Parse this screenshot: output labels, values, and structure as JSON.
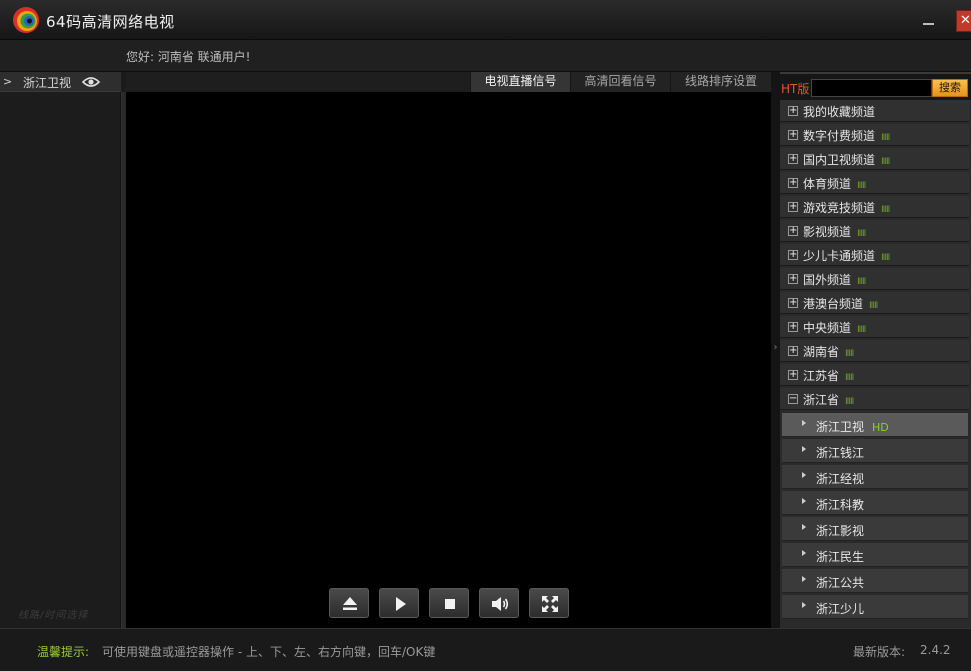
{
  "app": {
    "title": "64码高清网络电视"
  },
  "header": {
    "greeting": "您好: 河南省  联通用户!"
  },
  "left": {
    "arrow": ">",
    "channel": "浙江卫视",
    "footer": "线路/时间选择"
  },
  "tabs": [
    {
      "label": "电视直播信号",
      "active": true
    },
    {
      "label": "高清回看信号",
      "active": false
    },
    {
      "label": "线路排序设置",
      "active": false
    }
  ],
  "search": {
    "prefix": "HT版",
    "button": "搜索",
    "value": ""
  },
  "categories": [
    {
      "label": "我的收藏频道",
      "bars": "",
      "expanded": false
    },
    {
      "label": "数字付费频道",
      "bars": "IIIII",
      "expanded": false
    },
    {
      "label": "国内卫视频道",
      "bars": "IIIII",
      "expanded": false
    },
    {
      "label": "体育频道",
      "bars": "IIIII",
      "expanded": false
    },
    {
      "label": "游戏竞技频道",
      "bars": "IIIII",
      "expanded": false
    },
    {
      "label": "影视频道",
      "bars": "IIIII",
      "expanded": false
    },
    {
      "label": "少儿卡通频道",
      "bars": "IIIII",
      "expanded": false
    },
    {
      "label": "国外频道",
      "bars": "IIIII",
      "expanded": false
    },
    {
      "label": "港澳台频道",
      "bars": "IIIII",
      "expanded": false
    },
    {
      "label": "中央频道",
      "bars": "IIIII",
      "expanded": false
    },
    {
      "label": "湖南省",
      "bars": "IIIII",
      "expanded": false
    },
    {
      "label": "江苏省",
      "bars": "IIIII",
      "expanded": false
    },
    {
      "label": "浙江省",
      "bars": "IIIII",
      "expanded": true
    }
  ],
  "plus_sign": "+",
  "minus_sign": "−",
  "subchannels": [
    {
      "label": "浙江卫视",
      "badge": "HD",
      "active": true
    },
    {
      "label": "浙江钱江",
      "badge": "",
      "active": false
    },
    {
      "label": "浙江经视",
      "badge": "",
      "active": false
    },
    {
      "label": "浙江科教",
      "badge": "",
      "active": false
    },
    {
      "label": "浙江影视",
      "badge": "",
      "active": false
    },
    {
      "label": "浙江民生",
      "badge": "",
      "active": false
    },
    {
      "label": "浙江公共",
      "badge": "",
      "active": false
    },
    {
      "label": "浙江少儿",
      "badge": "",
      "active": false
    }
  ],
  "controls": [
    {
      "name": "eject-button",
      "icon": "eject-icon"
    },
    {
      "name": "play-button",
      "icon": "play-icon"
    },
    {
      "name": "stop-button",
      "icon": "stop-icon"
    },
    {
      "name": "volume-button",
      "icon": "volume-icon"
    },
    {
      "name": "fullscreen-button",
      "icon": "fullscreen-icon"
    }
  ],
  "status": {
    "tip_label": "温馨提示:",
    "tip_text": "可使用键盘或遥控器操作 - 上、下、左、右方向键，回车/OK键",
    "version_label": "最新版本:",
    "version": "2.4.2"
  },
  "colors": {
    "accent_orange": "#e6941a",
    "signal_green": "#6e9b27",
    "hd_green": "#8bcf2a",
    "close_red": "#c03a2b"
  }
}
